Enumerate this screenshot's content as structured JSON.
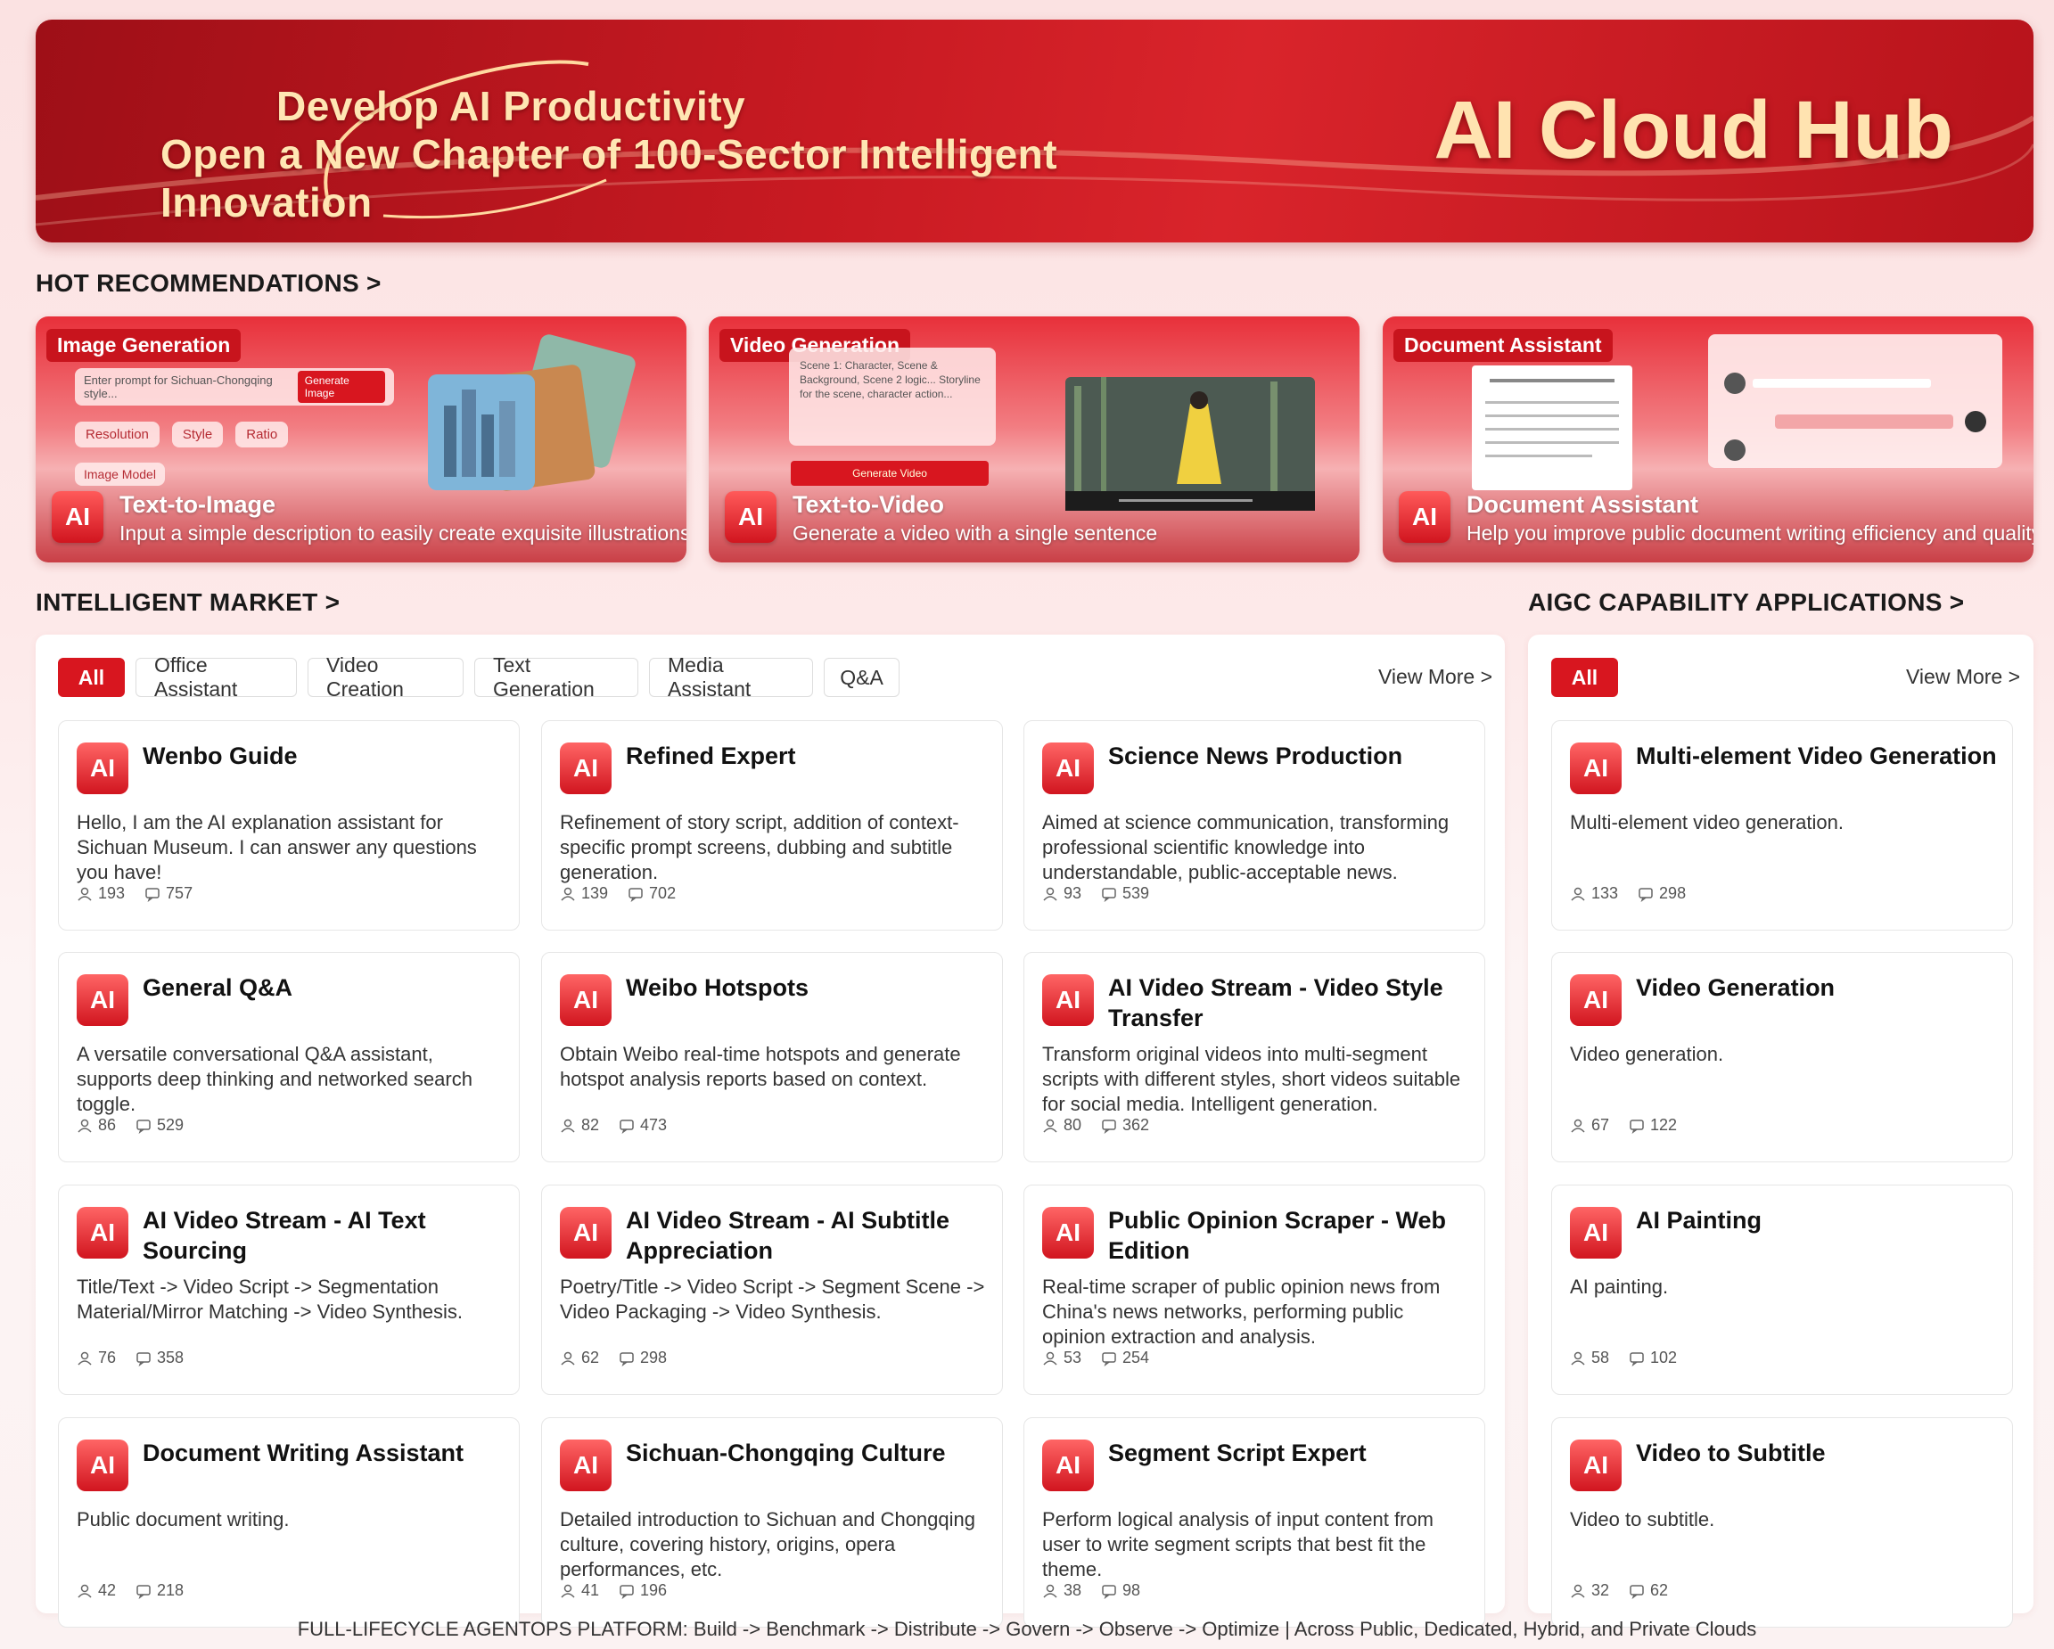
{
  "banner": {
    "slogan_line1": "Develop AI Productivity",
    "slogan_line2": "Open a New Chapter of 100-Sector Intelligent Innovation",
    "brand": "AI Cloud Hub"
  },
  "sections": {
    "hot": "HOT RECOMMENDATIONS >",
    "market": "INTELLIGENT MARKET >",
    "aigc": "AIGC CAPABILITY APPLICATIONS >"
  },
  "hot": [
    {
      "tag": "Image Generation",
      "title": "Text-to-Image",
      "desc": "Input a simple description to easily create exquisite illustrations",
      "mock": {
        "prompt": "Enter prompt for Sichuan-Chongqing style...",
        "btn": "Generate Image",
        "opts": [
          "Resolution",
          "Style",
          "Ratio",
          "Image Model"
        ]
      }
    },
    {
      "tag": "Video Generation",
      "title": "Text-to-Video",
      "desc": "Generate a video with a single sentence",
      "mock": {
        "script": "Scene 1: Character, Scene & Background, Scene 2 logic... Storyline for the scene, character action...",
        "btn": "Generate Video"
      }
    },
    {
      "tag": "Document Assistant",
      "title": "Document Assistant",
      "desc": "Help you improve public document writing efficiency and quality"
    }
  ],
  "market": {
    "chips": [
      "All",
      "Office Assistant",
      "Video Creation",
      "Text Generation",
      "Media Assistant",
      "Q&A"
    ],
    "view_more": "View More >",
    "cards": [
      {
        "title": "Wenbo Guide",
        "desc": "Hello, I am the AI explanation assistant for Sichuan Museum. I can answer any questions you have!",
        "users": "193",
        "comments": "757"
      },
      {
        "title": "Refined Expert",
        "desc": "Refinement of story script, addition of context-specific prompt screens, dubbing and subtitle generation.",
        "users": "139",
        "comments": "702"
      },
      {
        "title": "Science News Production",
        "desc": "Aimed at science communication, transforming professional scientific knowledge into understandable, public-acceptable news.",
        "users": "93",
        "comments": "539"
      },
      {
        "title": "General Q&A",
        "desc": "A versatile conversational Q&A assistant, supports deep thinking and networked search toggle.",
        "users": "86",
        "comments": "529"
      },
      {
        "title": "Weibo Hotspots",
        "desc": "Obtain Weibo real-time hotspots and generate hotspot analysis reports based on context.",
        "users": "82",
        "comments": "473"
      },
      {
        "title": "AI Video Stream - Video Style Transfer",
        "desc": "Transform original videos into multi-segment scripts with different styles, short videos suitable for social media. Intelligent generation.",
        "users": "80",
        "comments": "362"
      },
      {
        "title": "AI Video Stream - AI Text Sourcing",
        "desc": "Title/Text -> Video Script -> Segmentation Material/Mirror Matching -> Video Synthesis.",
        "users": "76",
        "comments": "358"
      },
      {
        "title": "AI Video Stream - AI Subtitle Appreciation",
        "desc": "Poetry/Title -> Video Script -> Segment Scene -> Video Packaging -> Video Synthesis.",
        "users": "62",
        "comments": "298"
      },
      {
        "title": "Public Opinion Scraper - Web Edition",
        "desc": "Real-time scraper of public opinion news from China's news networks, performing public opinion extraction and analysis.",
        "users": "53",
        "comments": "254"
      },
      {
        "title": "Document Writing Assistant",
        "desc": "Public document writing.",
        "users": "42",
        "comments": "218"
      },
      {
        "title": "Sichuan-Chongqing Culture",
        "desc": "Detailed introduction to Sichuan and Chongqing culture, covering history, origins, opera performances, etc.",
        "users": "41",
        "comments": "196"
      },
      {
        "title": "Segment Script Expert",
        "desc": "Perform logical analysis of input content from user to write segment scripts that best fit the theme.",
        "users": "38",
        "comments": "98"
      }
    ]
  },
  "aigc": {
    "chips": [
      "All"
    ],
    "view_more": "View More >",
    "cards": [
      {
        "title": "Multi-element Video Generation",
        "desc": "Multi-element video generation.",
        "users": "133",
        "comments": "298"
      },
      {
        "title": "Video Generation",
        "desc": "Video generation.",
        "users": "67",
        "comments": "122"
      },
      {
        "title": "AI Painting",
        "desc": "AI painting.",
        "users": "58",
        "comments": "102"
      },
      {
        "title": "Video to Subtitle",
        "desc": "Video to subtitle.",
        "users": "32",
        "comments": "62"
      }
    ]
  },
  "icon_label": "AI",
  "footer": "FULL-LIFECYCLE AGENTOPS PLATFORM: Build -> Benchmark -> Distribute -> Govern -> Observe -> Optimize  |  Across Public, Dedicated, Hybrid, and Private Clouds",
  "colors": {
    "accent": "#d8161f",
    "banner_gold": "#ffe3b0"
  }
}
